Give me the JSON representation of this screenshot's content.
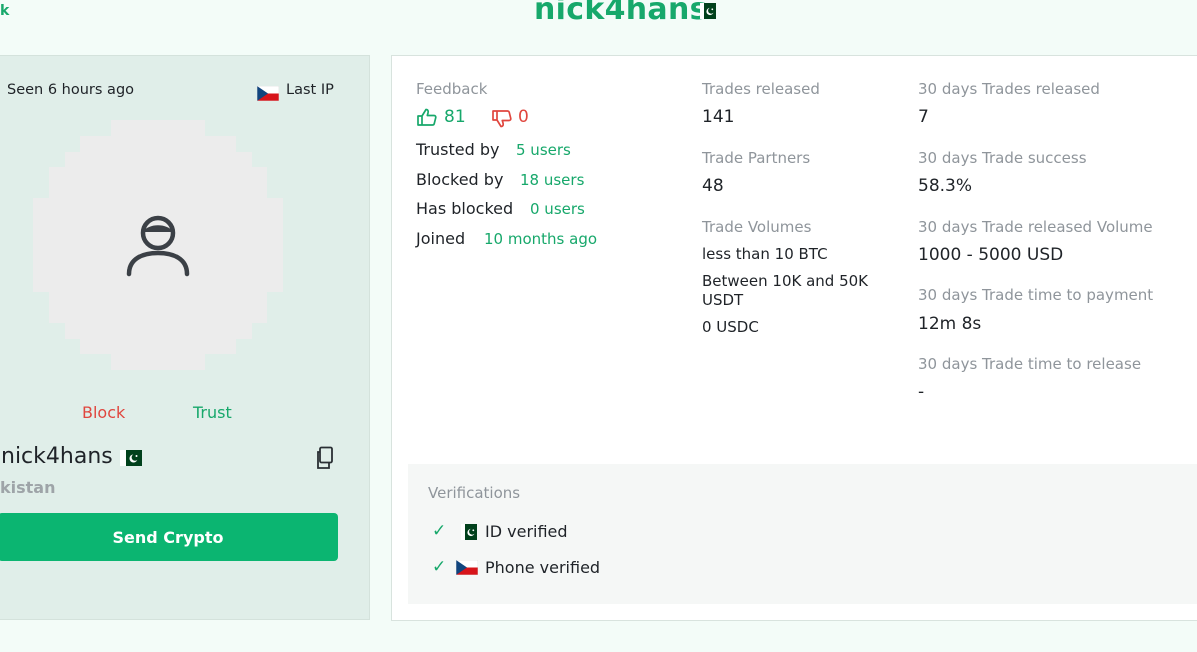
{
  "header": {
    "back_link": "k",
    "title": "nick4hans",
    "flag_icon": "pakistan-flag"
  },
  "profile": {
    "seen": "Seen 6 hours ago",
    "last_ip_label": "Last IP",
    "last_ip_flag": "czech-flag",
    "avatar_icon": "user-icon",
    "block_label": "Block",
    "trust_label": "Trust",
    "username": "nick4hans",
    "country": "kistan",
    "send_label": "Send Crypto"
  },
  "feedback": {
    "label": "Feedback",
    "positive": "81",
    "negative": "0",
    "rows": [
      {
        "label": "Trusted by",
        "value": "5 users"
      },
      {
        "label": "Blocked by",
        "value": "18 users"
      },
      {
        "label": "Has blocked",
        "value": "0 users"
      },
      {
        "label": "Joined",
        "value": "10 months ago"
      }
    ]
  },
  "trades": {
    "released_label": "Trades released",
    "released_value": "141",
    "partners_label": "Trade Partners",
    "partners_value": "48",
    "volumes_label": "Trade Volumes",
    "volumes": [
      "less than 10 BTC",
      "Between 10K and 50K USDT",
      "0 USDC"
    ]
  },
  "thirty_days": {
    "released_label": "30 days Trades released",
    "released_value": "7",
    "success_label": "30 days Trade success",
    "success_value": "58.3%",
    "volume_label": "30 days Trade released Volume",
    "volume_value": "1000 - 5000 USD",
    "payment_label": "30 days Trade time to payment",
    "payment_value": "12m 8s",
    "release_label": "30 days Trade time to release",
    "release_value": "-"
  },
  "verifications": {
    "label": "Verifications",
    "items": [
      {
        "text": "ID verified",
        "flag": "pakistan-flag"
      },
      {
        "text": "Phone verified",
        "flag": "czech-flag"
      }
    ]
  },
  "colors": {
    "accent": "#17a86b",
    "button": "#0bb571",
    "danger": "#e0463e",
    "page_bg": "#f3fcf8",
    "left_card_bg": "#e0eee9"
  }
}
